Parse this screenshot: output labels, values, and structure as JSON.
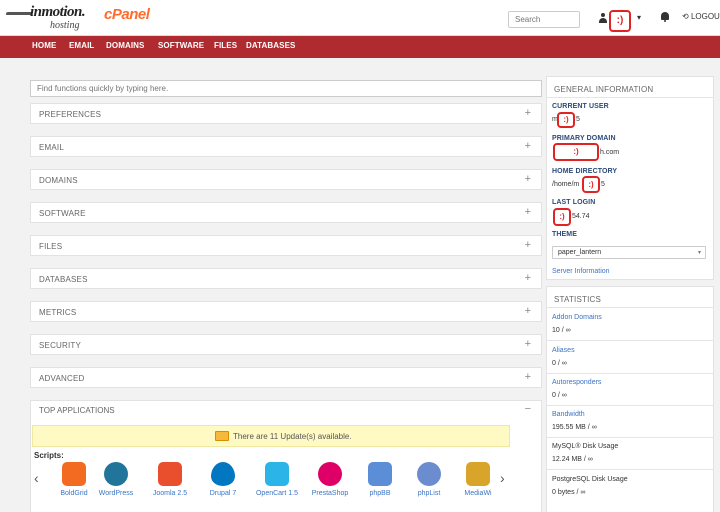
{
  "header": {
    "brand": "inmotion.",
    "brand_sub": "hosting",
    "product": "cPanel",
    "search_placeholder": "Search",
    "user_badge": ":)",
    "caret": "▾",
    "logout": "LOGOUT"
  },
  "nav": {
    "items": [
      "HOME",
      "EMAIL",
      "DOMAINS",
      "SOFTWARE",
      "FILES",
      "DATABASES"
    ]
  },
  "finder": {
    "placeholder": "Find functions quickly by typing here."
  },
  "groups": [
    {
      "label": "PREFERENCES",
      "sign": "+"
    },
    {
      "label": "EMAIL",
      "sign": "+"
    },
    {
      "label": "DOMAINS",
      "sign": "+"
    },
    {
      "label": "SOFTWARE",
      "sign": "+"
    },
    {
      "label": "FILES",
      "sign": "+"
    },
    {
      "label": "DATABASES",
      "sign": "+"
    },
    {
      "label": "METRICS",
      "sign": "+"
    },
    {
      "label": "SECURITY",
      "sign": "+"
    },
    {
      "label": "ADVANCED",
      "sign": "+"
    }
  ],
  "top_apps": {
    "title": "TOP APPLICATIONS",
    "sign": "−",
    "update_text": "There are 11 Update(s) available.",
    "scripts_label": "Scripts:",
    "prev": "‹",
    "next": "›",
    "apps": [
      {
        "name": "BoldGrid",
        "color": "#f36b21"
      },
      {
        "name": "WordPress",
        "color": "#21759b"
      },
      {
        "name": "Joomla 2.5",
        "color": "#e94e2d"
      },
      {
        "name": "Drupal 7",
        "color": "#0077c0"
      },
      {
        "name": "OpenCart 1.5",
        "color": "#2ab4e8"
      },
      {
        "name": "PrestaShop",
        "color": "#df0067"
      },
      {
        "name": "phpBB",
        "color": "#5b8ed6"
      },
      {
        "name": "phpList",
        "color": "#6b8ccf"
      },
      {
        "name": "MediaWi",
        "color": "#d9a42a"
      }
    ]
  },
  "general_info": {
    "title": "GENERAL INFORMATION",
    "current_user_label": "CURRENT USER",
    "current_user_value_start": "m",
    "current_user_value_end": "5",
    "primary_domain_label": "PRIMARY DOMAIN",
    "primary_domain_value_end": "h.com",
    "home_directory_label": "HOME DIRECTORY",
    "home_directory_value_start": "/home/m",
    "home_directory_value_end": "5",
    "last_login_label": "LAST LOGIN",
    "last_login_value_end": "54.74",
    "theme_label": "THEME",
    "theme_value": "paper_lantern",
    "server_info_link": "Server Information",
    "redacted": ":)"
  },
  "statistics": {
    "title": "STATISTICS",
    "items": [
      {
        "label": "Addon Domains",
        "value": "10 / ∞"
      },
      {
        "label": "Aliases",
        "value": "0 / ∞"
      },
      {
        "label": "Autoresponders",
        "value": "0 / ∞"
      },
      {
        "label": "Bandwidth",
        "value": "195.55 MB / ∞"
      },
      {
        "label": "MySQL® Disk Usage",
        "value": "12.24 MB / ∞"
      },
      {
        "label": "PostgreSQL Disk Usage",
        "value": "0 bytes / ∞"
      }
    ]
  },
  "colors": {
    "nav_bg": "#b02b30",
    "accent_orange": "#ff6c2c",
    "link_blue": "#3b74c4",
    "redaction_red": "#e02424"
  }
}
